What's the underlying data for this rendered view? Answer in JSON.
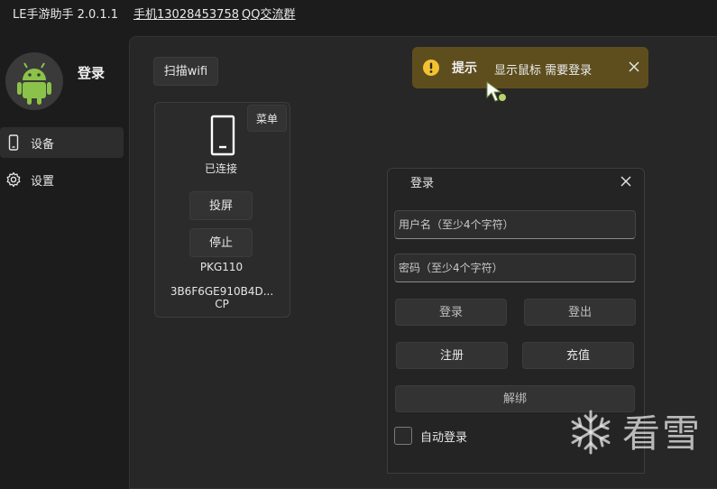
{
  "titlebar": {
    "app_title": "LE手游助手 2.0.1.1",
    "phone_link": "手机13028453758",
    "qq_link": "QQ交流群"
  },
  "sidebar": {
    "login_label": "登录",
    "items": [
      {
        "label": "设备",
        "icon": "phone-icon",
        "active": true
      },
      {
        "label": "设置",
        "icon": "gear-icon",
        "active": false
      }
    ]
  },
  "toolbar": {
    "scan_wifi_label": "扫描wifi"
  },
  "device": {
    "menu_label": "菜单",
    "status": "已连接",
    "cast_label": "投屏",
    "stop_label": "停止",
    "model": "PKG110",
    "serial": "3B6F6GE910B4D...",
    "serial_suffix": "CP"
  },
  "toast": {
    "title": "提示",
    "message": "显示鼠标 需要登录",
    "accent": "#5e4e1e",
    "icon": "warning-icon"
  },
  "login_dialog": {
    "title": "登录",
    "username_placeholder": "用户名（至少4个字符）",
    "password_placeholder": "密码（至少4个字符）",
    "login_label": "登录",
    "logout_label": "登出",
    "register_label": "注册",
    "recharge_label": "充值",
    "unbind_label": "解绑",
    "auto_login_label": "自动登录",
    "auto_login_checked": false
  },
  "watermark": {
    "text": "看雪",
    "icon": "snowflake-icon"
  },
  "colors": {
    "background": "#1c1c1c",
    "panel": "#272727",
    "android_green": "#8bc34a"
  }
}
